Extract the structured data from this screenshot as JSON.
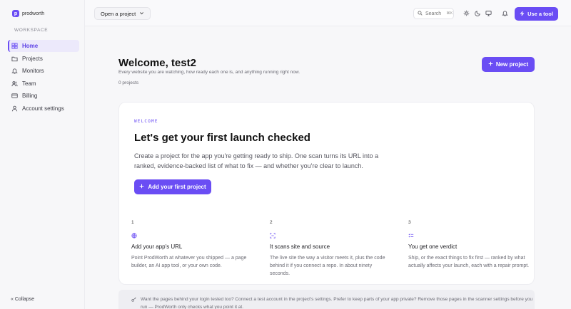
{
  "brand": {
    "name": "prodworth",
    "mark": "p"
  },
  "sidebar": {
    "section_label": "WORKSPACE",
    "items": [
      {
        "label": "Home",
        "icon": "home-icon",
        "active": true
      },
      {
        "label": "Projects",
        "icon": "folder-icon",
        "active": false
      },
      {
        "label": "Monitors",
        "icon": "bell-icon",
        "active": false
      },
      {
        "label": "Team",
        "icon": "users-icon",
        "active": false
      },
      {
        "label": "Billing",
        "icon": "credit-card-icon",
        "active": false
      },
      {
        "label": "Account settings",
        "icon": "user-icon",
        "active": false
      }
    ],
    "collapse_label": "« Collapse"
  },
  "topbar": {
    "project_select": "Open a project",
    "search_label": "Search",
    "search_shortcut": "⌘K",
    "use_tool_label": "Use a tool"
  },
  "main": {
    "welcome_title": "Welcome, test2",
    "welcome_subtitle": "Every website you are watching, how ready each one is, and anything running right now.",
    "project_count": "0 projects",
    "new_project_label": "New project"
  },
  "card": {
    "eyebrow": "WELCOME",
    "title": "Let's get your first launch checked",
    "description": "Create a project for the app you're getting ready to ship. One scan turns its URL into a ranked, evidence-backed list of what to fix — and whether you're clear to launch.",
    "cta_label": "Add your first project",
    "steps": [
      {
        "number": "1",
        "icon": "globe-icon",
        "title": "Add your app's URL",
        "text": "Point ProdWorth at whatever you shipped — a page builder, an AI app tool, or your own code."
      },
      {
        "number": "2",
        "icon": "scan-icon",
        "title": "It scans site and source",
        "text": "The live site the way a visitor meets it, plus the code behind it if you connect a repo. In about ninety seconds."
      },
      {
        "number": "3",
        "icon": "list-check-icon",
        "title": "You get one verdict",
        "text": "Ship, or the exact things to fix first — ranked by what actually affects your launch, each with a repair prompt."
      }
    ]
  },
  "tip": {
    "icon": "key-icon",
    "text": "Want the pages behind your login tested too? Connect a test account in the project's settings. Prefer to keep parts of your app private? Remove those pages in the scanner settings before you run — ProdWorth only checks what you point it at."
  },
  "colors": {
    "accent": "#6a4df4",
    "active_bg": "#ece9fb",
    "page_bg": "#f7f7f9"
  }
}
